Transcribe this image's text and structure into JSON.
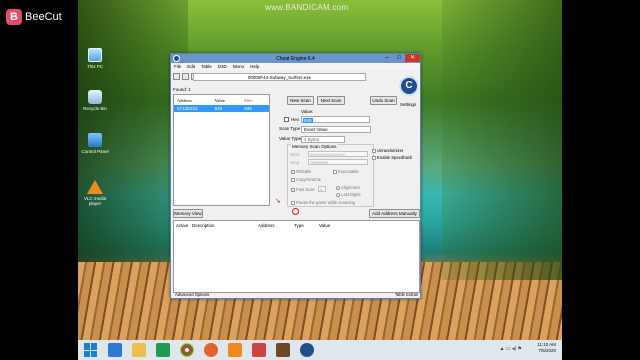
{
  "recorder": {
    "beecut_label": "BeeCut",
    "bandicam_label": "www.BANDICAM.com"
  },
  "desktop_icons": [
    {
      "name": "This PC"
    },
    {
      "name": "Recycle Bin"
    },
    {
      "name": "Control Panel"
    },
    {
      "name": "VLC media player"
    }
  ],
  "desktop_ce_icon": {
    "label": "Settings"
  },
  "window": {
    "title": "Cheat Engine 6.4",
    "menu": [
      "File",
      "Edit",
      "Table",
      "D3D",
      "Mono",
      "Help"
    ],
    "process": "00000F44-Subway_Surfers.exe",
    "found_label": "Found: 1",
    "results_headers": [
      "Address",
      "Value",
      "Prev"
    ],
    "results_rows": [
      {
        "address": "0722E810",
        "value": "949",
        "prev": "949"
      }
    ],
    "buttons": {
      "new_scan": "New Scan",
      "next_scan": "Next Scan",
      "undo_scan": "Undo Scan",
      "settings": "Settings",
      "memory_view": "Memory View",
      "add_address": "Add Address Manually"
    },
    "value_label": "Value:",
    "hex_label": "Hex",
    "value_input": "949",
    "scan_type_label": "Scan Type",
    "scan_type_value": "Exact Value",
    "value_type_label": "Value Type",
    "value_type_value": "4 Bytes",
    "mem_options": {
      "title": "Memory Scan Options",
      "start_label": "Start",
      "start_value": "0000000000000000",
      "stop_label": "Stop",
      "stop_value": "7fffffffffffffff",
      "writable": "Writable",
      "executable": "Executable",
      "copyonwrite": "CopyOnWrite",
      "fastscan": "Fast Scan",
      "fastscan_value": "4",
      "alignment": "Alignment",
      "last_digits": "Last Digits",
      "pause": "Pause the game while scanning"
    },
    "unrandomizer": "Unrandomizer",
    "enable_speedhack": "Enable Speedhack",
    "addr_list_headers": [
      "Active",
      "Description",
      "Address",
      "Type",
      "Value"
    ],
    "footer_left": "Advanced Options",
    "footer_right": "Table Extras"
  },
  "taskbar": {
    "time": "11:10 AM",
    "date": "7/5/2020"
  }
}
